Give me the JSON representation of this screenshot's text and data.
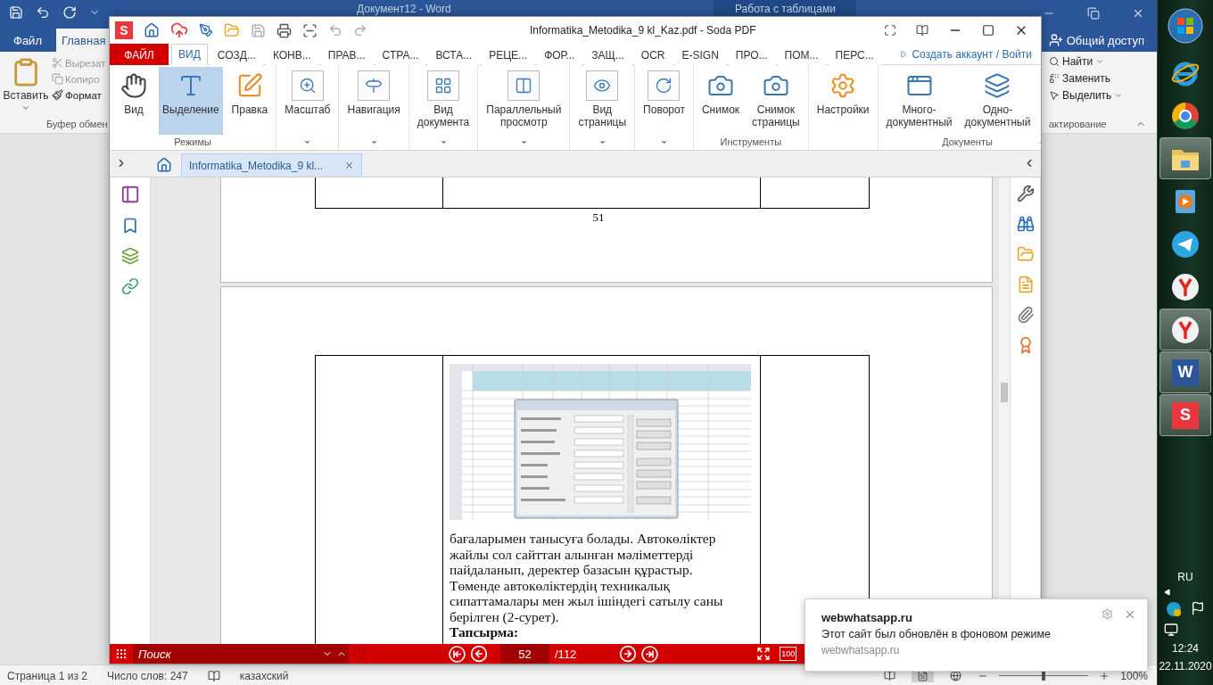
{
  "word": {
    "title": "Документ12 - Word",
    "context_tab": "Работа с таблицами",
    "tabs": [
      {
        "label": "Файл",
        "selected": false
      },
      {
        "label": "Главная",
        "selected": true
      }
    ],
    "share": "Общий доступ",
    "clipboard": {
      "paste": "Вставить",
      "group": "Буфер обмен",
      "items": [
        {
          "label": "Вырезат",
          "disabled": true
        },
        {
          "label": "Копиро",
          "disabled": true
        },
        {
          "label": "Формат",
          "disabled": false
        }
      ]
    },
    "editing": {
      "group": "актирование",
      "items": [
        {
          "label": "Найти",
          "dropdown": true
        },
        {
          "label": "Заменить",
          "dropdown": false
        },
        {
          "label": "Выделить",
          "dropdown": true
        }
      ]
    },
    "status": {
      "page": "Страница 1 из 2",
      "words": "Число слов: 247",
      "language": "казахский",
      "zoom": "100%",
      "zoom_slider": {
        "level": 0.5
      }
    }
  },
  "soda": {
    "logo": "S",
    "title": "Informatika_Metodika_9 kl_Kaz.pdf - Soda PDF",
    "tabs": [
      {
        "label": "ФАЙЛ",
        "kind": "file",
        "selected": false
      },
      {
        "label": "ВИД",
        "kind": "tab",
        "selected": true
      },
      {
        "label": "СОЗД...",
        "kind": "tab",
        "selected": false
      },
      {
        "label": "КОНВ...",
        "kind": "tab",
        "selected": false
      },
      {
        "label": "ПРАВ...",
        "kind": "tab",
        "selected": false
      },
      {
        "label": "СТРА...",
        "kind": "tab",
        "selected": false
      },
      {
        "label": "ВСТА...",
        "kind": "tab",
        "selected": false
      },
      {
        "label": "РЕЦЕ...",
        "kind": "tab",
        "selected": false
      },
      {
        "label": "ФОР...",
        "kind": "tab",
        "selected": false
      },
      {
        "label": "ЗАЩ...",
        "kind": "tab",
        "selected": false
      },
      {
        "label": "OCR",
        "kind": "tab",
        "selected": false
      },
      {
        "label": "E-SIGN",
        "kind": "tab",
        "selected": false
      },
      {
        "label": "ПРО...",
        "kind": "tab",
        "selected": false
      },
      {
        "label": "ПОМ...",
        "kind": "tab",
        "selected": false
      },
      {
        "label": "ПЕРС...",
        "kind": "tab",
        "selected": false
      }
    ],
    "account": "Создать аккаунт / Войти",
    "ribbon": [
      {
        "label": "Режимы",
        "dropdown": false,
        "buttons": [
          {
            "label": "Вид",
            "selected": false
          },
          {
            "label": "Выделение",
            "selected": true
          },
          {
            "label": "Правка",
            "selected": false
          }
        ]
      },
      {
        "dropdown": true,
        "buttons": [
          {
            "label": "Масштаб",
            "selected": false
          }
        ]
      },
      {
        "dropdown": true,
        "buttons": [
          {
            "label": "Навигация",
            "selected": false
          }
        ]
      },
      {
        "dropdown": true,
        "buttons": [
          {
            "label": "Вид\nдокумента",
            "selected": false
          }
        ]
      },
      {
        "dropdown": true,
        "buttons": [
          {
            "label": "Параллельный\nпросмотр",
            "selected": false
          }
        ]
      },
      {
        "dropdown": true,
        "buttons": [
          {
            "label": "Вид\nстраницы",
            "selected": false
          }
        ]
      },
      {
        "dropdown": true,
        "buttons": [
          {
            "label": "Поворот",
            "selected": false
          }
        ]
      },
      {
        "label": "Инструменты",
        "dropdown": false,
        "buttons": [
          {
            "label": "Снимок",
            "selected": false
          },
          {
            "label": "Снимок\nстраницы",
            "selected": false
          }
        ]
      },
      {
        "dropdown": false,
        "buttons": [
          {
            "label": "Настройки",
            "selected": false
          }
        ]
      },
      {
        "label": "Документы",
        "dropdown": false,
        "buttons": [
          {
            "label": "Много-\nдокументный",
            "selected": false
          },
          {
            "label": "Одно-\nдокументный",
            "selected": false
          }
        ]
      }
    ],
    "doc_tab": "Informatika_Metodika_9 kl...",
    "page_number": "51",
    "text_lines": [
      "бағаларымен танысуға болады. Автокөліктер",
      "жайлы сол сайттан алынған  мәліметтерді",
      "пайдаланып, деректер базасын құрастыр.",
      "Төменде автокөліктердің техникалық",
      "сипаттамалары мен  жыл ішіндегі сатылу саны",
      "берілген (2-сурет)."
    ],
    "heading": "Тапсырма:",
    "bottom_bar": {
      "search_placeholder": "Поиск",
      "page": "52",
      "total": "/112",
      "zoom_box": "100"
    }
  },
  "notification": {
    "title": "webwhatsapp.ru",
    "message": "Этот сайт был обновлён в фоновом режиме",
    "source": "webwhatsapp.ru"
  },
  "taskbar": {
    "apps": [
      {
        "kind": "start",
        "open": false
      },
      {
        "kind": "ie",
        "open": false
      },
      {
        "kind": "chrome",
        "open": false
      },
      {
        "kind": "folder",
        "open": true
      },
      {
        "kind": "media",
        "open": false
      },
      {
        "kind": "telegram",
        "open": false
      },
      {
        "kind": "yandex",
        "open": false
      },
      {
        "kind": "yandex",
        "open": true
      },
      {
        "kind": "word",
        "open": true,
        "label": "W"
      },
      {
        "kind": "soda",
        "open": true,
        "label": "S"
      }
    ],
    "language": "RU",
    "time": "12:24",
    "date": "22.11.2020"
  }
}
